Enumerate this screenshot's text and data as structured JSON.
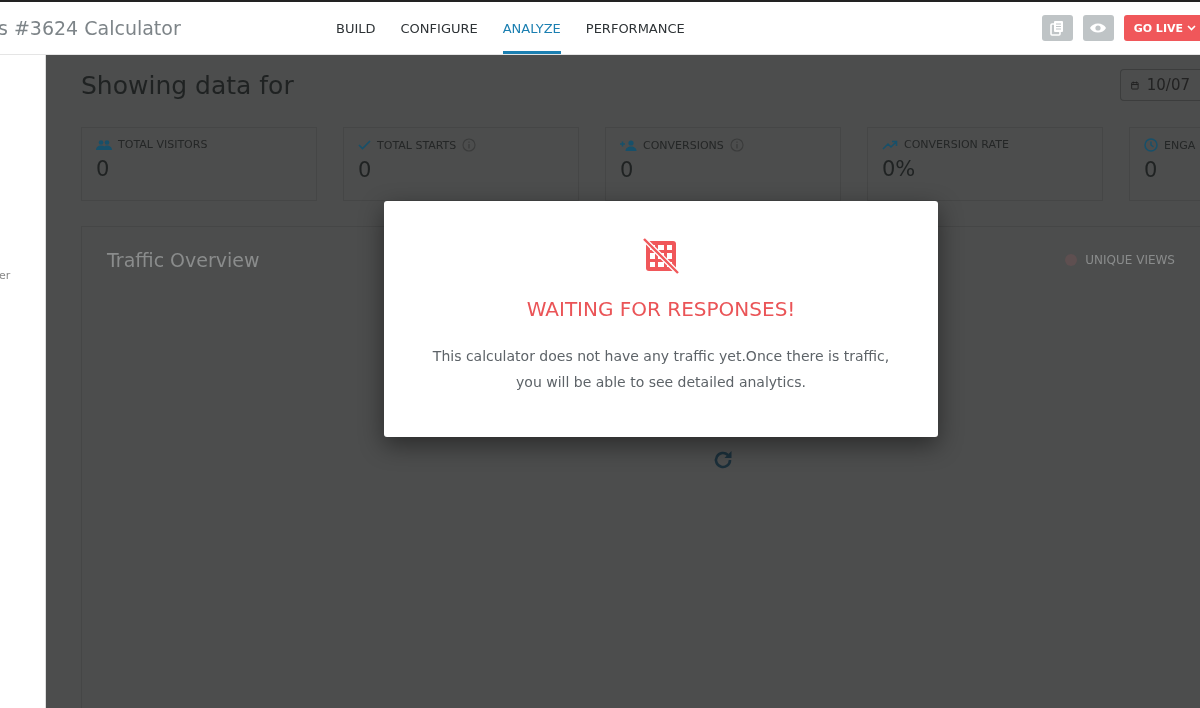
{
  "header": {
    "title": "s #3624 Calculator",
    "tabs": [
      {
        "label": "BUILD",
        "selected": false
      },
      {
        "label": "CONFIGURE",
        "selected": false
      },
      {
        "label": "ANALYZE",
        "selected": true
      },
      {
        "label": "PERFORMANCE",
        "selected": false
      }
    ],
    "go_live": "GO LIVE"
  },
  "sidebar": {
    "text": "er"
  },
  "page": {
    "heading": "Showing data for",
    "date": "10/07"
  },
  "stats": [
    {
      "kind": "visitors",
      "label": "TOTAL VISITORS",
      "value": "0",
      "info": false
    },
    {
      "kind": "starts",
      "label": "TOTAL STARTS",
      "value": "0",
      "info": true
    },
    {
      "kind": "conversions",
      "label": "CONVERSIONS",
      "value": "0",
      "info": true
    },
    {
      "kind": "rate",
      "label": "CONVERSION RATE",
      "value": "0%",
      "info": false
    },
    {
      "kind": "engagement",
      "label": "ENGA",
      "value": "0"
    }
  ],
  "chart": {
    "title": "Traffic Overview",
    "legend": "UNIQUE VIEWS"
  },
  "modal": {
    "title": "WAITING FOR RESPONSES!",
    "message": "This calculator does not have any traffic yet.Once there is traffic, you will be able to see detailed analytics."
  }
}
